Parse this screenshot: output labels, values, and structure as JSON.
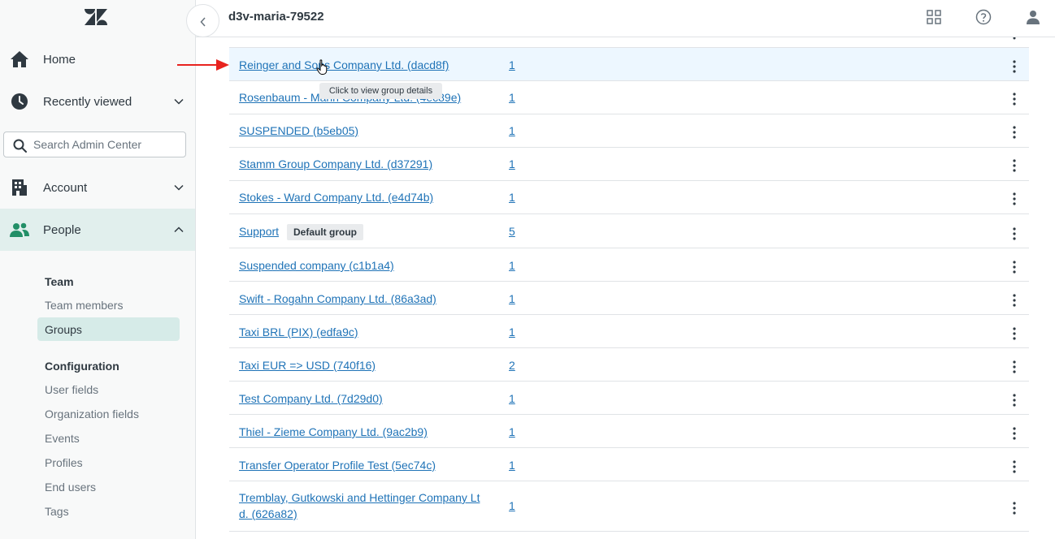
{
  "header": {
    "title": "d3v-maria-79522"
  },
  "sidebar": {
    "nav": [
      {
        "label": "Home",
        "icon": "home-icon"
      },
      {
        "label": "Recently viewed",
        "icon": "clock-icon"
      },
      {
        "label": "Account",
        "icon": "building-icon"
      },
      {
        "label": "People",
        "icon": "people-icon"
      }
    ],
    "search_placeholder": "Search Admin Center",
    "team_heading": "Team",
    "team_items": [
      "Team members",
      "Groups"
    ],
    "config_heading": "Configuration",
    "config_items": [
      "User fields",
      "Organization fields",
      "Events",
      "Profiles",
      "End users",
      "Tags"
    ]
  },
  "tooltip": "Click to view group details",
  "rows": [
    {
      "name": "Reinger and Sons Company Ltd. (dacd8f)",
      "count": "1"
    },
    {
      "name": "Rosenbaum - Mann Company Ltd. (4ec89e)",
      "count": "1"
    },
    {
      "name": "SUSPENDED (b5eb05)",
      "count": "1"
    },
    {
      "name": "Stamm Group Company Ltd. (d37291)",
      "count": "1"
    },
    {
      "name": "Stokes - Ward Company Ltd. (e4d74b)",
      "count": "1"
    },
    {
      "name": "Support",
      "badge": "Default group",
      "count": "5"
    },
    {
      "name": "Suspended company (c1b1a4)",
      "count": "1"
    },
    {
      "name": "Swift - Rogahn Company Ltd. (86a3ad)",
      "count": "1"
    },
    {
      "name": "Taxi BRL (PIX) (edfa9c)",
      "count": "1"
    },
    {
      "name": "Taxi EUR => USD (740f16)",
      "count": "2"
    },
    {
      "name": "Test Company Ltd. (7d29d0)",
      "count": "1"
    },
    {
      "name": "Thiel - Zieme Company Ltd. (9ac2b9)",
      "count": "1"
    },
    {
      "name": "Transfer Operator Profile Test (5ec74c)",
      "count": "1"
    },
    {
      "name_line1": "Tremblay, Gutkowski and Hettinger Company Lt",
      "name_line2": "d. (626a82)",
      "count": "1"
    }
  ],
  "colors": {
    "link": "#1f73b7",
    "active_nav_bg": "#e1efed",
    "selected_item_bg": "#d6ebe8",
    "hover_row_bg": "#edf7ff",
    "annotation_arrow": "#e8231f"
  }
}
